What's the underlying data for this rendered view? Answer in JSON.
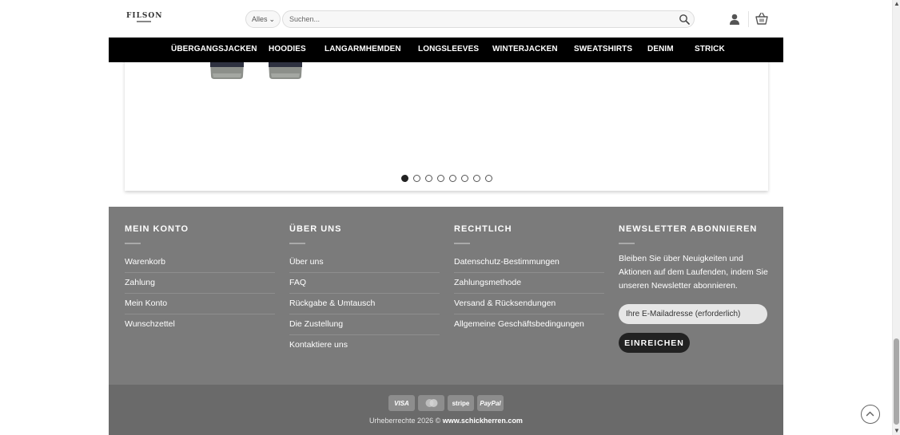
{
  "header": {
    "logo_text": "FILSON",
    "category_select": "Alles",
    "search_placeholder": "Suchen..."
  },
  "nav": {
    "items": [
      {
        "label": "Übergangsjacken"
      },
      {
        "label": "Hoodies"
      },
      {
        "label": "Langarmhemden"
      },
      {
        "label": "Longsleeves"
      },
      {
        "label": "Winterjacken"
      },
      {
        "label": "Sweatshirts"
      },
      {
        "label": "Denim"
      },
      {
        "label": "Strick"
      }
    ]
  },
  "slider": {
    "dot_count": 8,
    "active_dot": 1
  },
  "footer": {
    "account": {
      "title": "Mein Konto",
      "links": [
        "Warenkorb",
        "Zahlung",
        "Mein Konto",
        "Wunschzettel"
      ]
    },
    "about": {
      "title": "Über uns",
      "links": [
        "Über uns",
        "FAQ",
        "Rückgabe & Umtausch",
        "Die Zustellung",
        "Kontaktiere uns"
      ]
    },
    "legal": {
      "title": "Rechtlich",
      "links": [
        "Datenschutz-Bestimmungen",
        "Zahlungsmethode",
        "Versand & Rücksendungen",
        "Allgemeine Geschäftsbedingungen"
      ]
    },
    "newsletter": {
      "title": "Newsletter abonnieren",
      "text": "Bleiben Sie über Neuigkeiten und Aktionen auf dem Laufenden, indem Sie unseren Newsletter abonnieren.",
      "input_placeholder": "Ihre E-Mailadresse (erforderlich)",
      "button_label": "Einreichen"
    }
  },
  "bottom": {
    "payment_methods": [
      "VISA",
      "mastercard",
      "stripe",
      "PayPal"
    ],
    "copyright_prefix": "Urheberrechte 2026 ©",
    "copyright_site": "www.schickherren.com"
  },
  "colors": {
    "nav_bg": "#000000",
    "footer_bg": "#7b7b7b",
    "bottom_bg": "#6a6a6a",
    "button_bg": "#222222"
  }
}
